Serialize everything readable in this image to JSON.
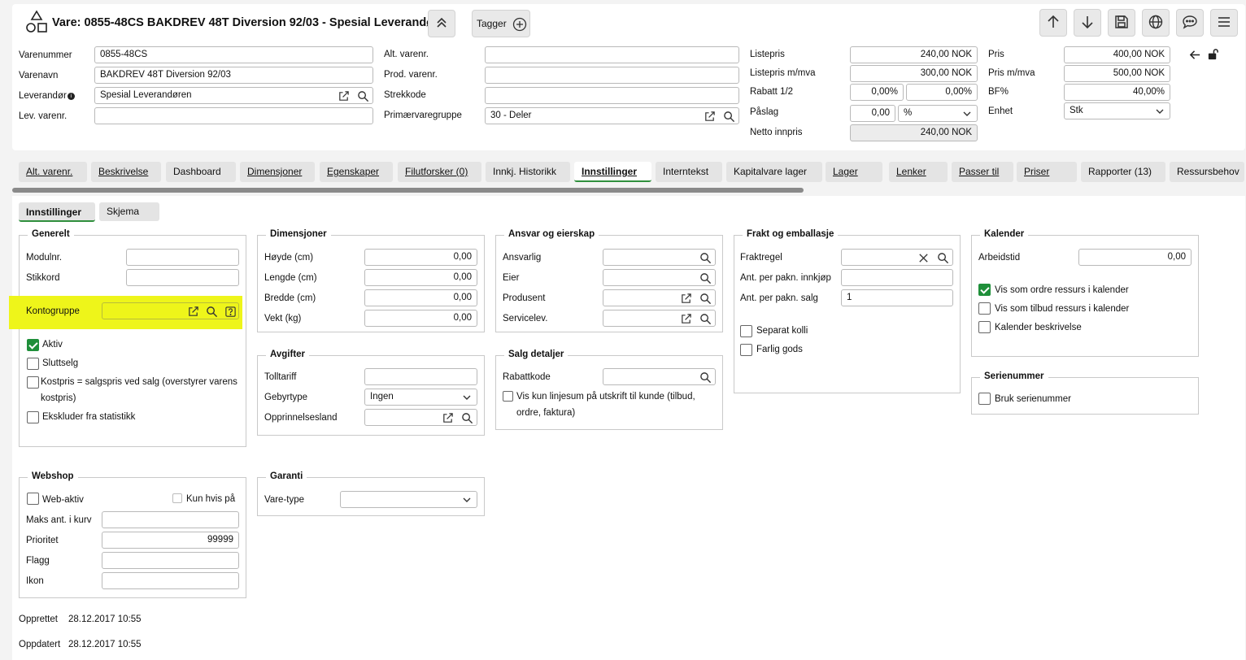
{
  "header": {
    "title": "Vare: 0855-48CS BAKDREV 48T Diversion 92/03 - Spesial Leverandøren",
    "tags_label": "Tagger"
  },
  "form": {
    "varenummer_label": "Varenummer",
    "varenummer": "0855-48CS",
    "varenavn_label": "Varenavn",
    "varenavn": "BAKDREV 48T Diversion 92/03",
    "leverandor_label": "Leverandør",
    "leverandor": "Spesial Leverandøren",
    "levvarenr_label": "Lev. varenr.",
    "levvarenr": "",
    "altvarenr_label": "Alt. varenr.",
    "altvarenr": "",
    "prodvarenr_label": "Prod. varenr.",
    "prodvarenr": "",
    "strekkode_label": "Strekkode",
    "strekkode": "",
    "primarvaregruppe_label": "Primærvaregruppe",
    "primarvaregruppe": "30 - Deler",
    "listepris_label": "Listepris",
    "listepris": "240,00 NOK",
    "listepris_mva_label": "Listepris m/mva",
    "listepris_mva": "300,00 NOK",
    "rabatt_label": "Rabatt 1/2",
    "rabatt1": "0,00%",
    "rabatt2": "0,00%",
    "paslag_label": "Påslag",
    "paslag": "0,00",
    "paslag_unit": "%",
    "netto_label": "Netto innpris",
    "netto": "240,00 NOK",
    "pris_label": "Pris",
    "pris": "400,00 NOK",
    "pris_mva_label": "Pris m/mva",
    "pris_mva": "500,00 NOK",
    "bf_label": "BF%",
    "bf": "40,00%",
    "enhet_label": "Enhet",
    "enhet": "Stk"
  },
  "tabs": [
    {
      "label": "Alt. varenr."
    },
    {
      "label": "Beskrivelse"
    },
    {
      "label": "Dashboard"
    },
    {
      "label": "Dimensjoner"
    },
    {
      "label": "Egenskaper"
    },
    {
      "label": "Filutforsker (0)"
    },
    {
      "label": "Innkj. Historikk"
    },
    {
      "label": "Innstillinger"
    },
    {
      "label": "Interntekst"
    },
    {
      "label": "Kapitalvare lager"
    },
    {
      "label": "Lager"
    },
    {
      "label": "Lenker"
    },
    {
      "label": "Passer til"
    },
    {
      "label": "Priser"
    },
    {
      "label": "Rapporter (13)"
    },
    {
      "label": "Ressursbehov"
    }
  ],
  "subtabs": [
    {
      "label": "Innstillinger"
    },
    {
      "label": "Skjema"
    }
  ],
  "generelt": {
    "title": "Generelt",
    "modulnr_label": "Modulnr.",
    "stikkord_label": "Stikkord",
    "kontogruppe_label": "Kontogruppe",
    "aktiv_label": "Aktiv",
    "sluttselg_label": "Sluttselg",
    "kostpris_label_1": "Kostpris = salgspris ved salg (overstyrer varens",
    "kostpris_label_2": "kostpris)",
    "ekskluder_label": "Ekskluder fra statistikk"
  },
  "dimensjoner": {
    "title": "Dimensjoner",
    "hoyde_label": "Høyde (cm)",
    "hoyde": "0,00",
    "lengde_label": "Lengde (cm)",
    "lengde": "0,00",
    "bredde_label": "Bredde (cm)",
    "bredde": "0,00",
    "vekt_label": "Vekt (kg)",
    "vekt": "0,00"
  },
  "ansvar": {
    "title": "Ansvar og eierskap",
    "ansvarlig_label": "Ansvarlig",
    "eier_label": "Eier",
    "produsent_label": "Produsent",
    "servicelev_label": "Servicelev."
  },
  "frakt": {
    "title": "Frakt og emballasje",
    "fraktregel_label": "Fraktregel",
    "innkjop_label": "Ant. per pakn. innkjøp",
    "salg_label": "Ant. per pakn. salg",
    "salg": "1",
    "separat_label": "Separat kolli",
    "farlig_label": "Farlig gods"
  },
  "kalender": {
    "title": "Kalender",
    "arbeidstid_label": "Arbeidstid",
    "arbeidstid": "0,00",
    "ordre_label": "Vis som ordre ressurs i kalender",
    "tilbud_label": "Vis som tilbud ressurs i kalender",
    "beskrivelse_label": "Kalender beskrivelse"
  },
  "avgifter": {
    "title": "Avgifter",
    "tolltariff_label": "Tolltariff",
    "gebyrtype_label": "Gebyrtype",
    "gebyrtype": "Ingen",
    "opprinnelse_label": "Opprinnelsesland"
  },
  "salg": {
    "title": "Salg detaljer",
    "rabattkode_label": "Rabattkode",
    "linjesum_label_1": "Vis kun linjesum på utskrift til kunde (tilbud,",
    "linjesum_label_2": "ordre, faktura)"
  },
  "serienummer": {
    "title": "Serienummer",
    "bruk_label": "Bruk serienummer"
  },
  "webshop": {
    "title": "Webshop",
    "webaktiv_label": "Web-aktiv",
    "kunhvis_label": "Kun hvis på",
    "maks_label": "Maks ant. i kurv",
    "prioritet_label": "Prioritet",
    "prioritet": "99999",
    "flagg_label": "Flagg",
    "ikon_label": "Ikon"
  },
  "garanti": {
    "title": "Garanti",
    "varetype_label": "Vare-type"
  },
  "meta": {
    "opprettet_label": "Opprettet",
    "opprettet": "28.12.2017 10:55",
    "oppdatert_label": "Oppdatert",
    "oppdatert": "28.12.2017 10:55"
  },
  "colors": {
    "highlight": "#eef51a",
    "accent": "#1f8f3a"
  }
}
